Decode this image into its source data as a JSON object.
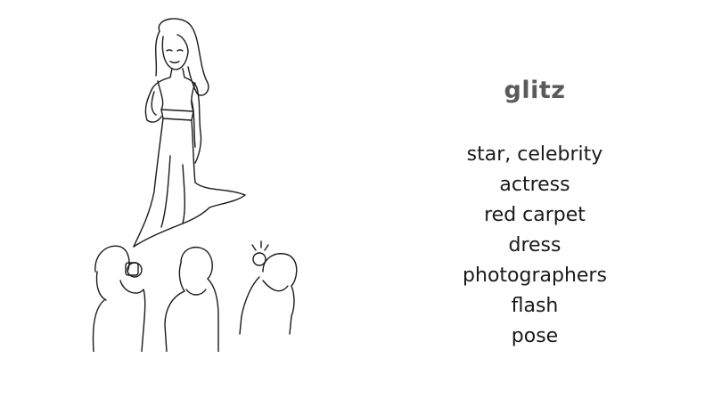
{
  "slide": {
    "title": "glitz",
    "words": [
      "star, celebrity",
      "actress",
      "red carpet",
      "dress",
      "photographers",
      "flash",
      "pose"
    ]
  },
  "illustration": {
    "icon": "celebrity-with-photographers-drawing"
  },
  "colors": {
    "title": "#5a5a5a",
    "text": "#1a1a1a",
    "background": "#ffffff"
  }
}
